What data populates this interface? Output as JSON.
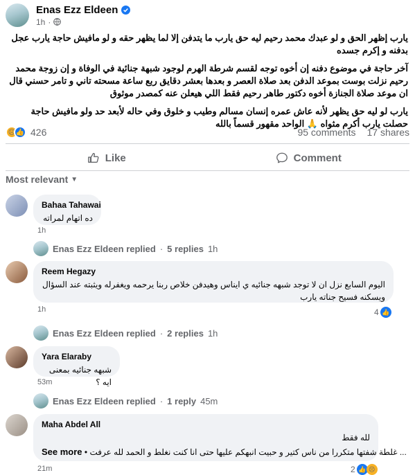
{
  "post": {
    "author": "Enas Ezz Eldeen",
    "time": "1h",
    "paragraphs": [
      "يارب إظهر الحق و لو عبدك محمد رحيم ليه حق يارب ما يتدفن إلا لما يظهر حقه و لو مافيش حاجة يارب عجل بدفنه و إكرم جسده",
      "آخر حاجة في موضوع دفنه إن أخوه توجه لقسم شرطة الهرم لوجود شبهة جنائية في الوفاة و إن زوجة محمد رحيم نزلت بوست بموعد الدفن بعد صلاة العصر و بعدها بعشر دقايق ربع ساعة مسحته تاني و تامر حسني قال ان موعد صلاة الجنازة أخوه دكتور طاهر رحيم فقط اللي هيعلن عنه كمصدر موثوق",
      "يارب لو ليه حق يظهر لأنه عاش عمره إنسان مسالم وطيب و خلوق وفي حاله لأبعد حد ولو مافيش حاجة حصلت يارب أكرم مثواه 🙏 الواحد مقهور قسماً بالله"
    ],
    "reaction_count": "426",
    "comments_count": "95 comments",
    "shares_count": "17 shares"
  },
  "actions": {
    "like": "Like",
    "comment": "Comment"
  },
  "sort_label": "Most relevant",
  "comments": [
    {
      "name": "Bahaa Tahawai",
      "text": "ده اتهام لمراته",
      "time": "1h",
      "reply_author": "Enas Ezz Eldeen replied",
      "reply_count": "5 replies",
      "reply_time": "1h"
    },
    {
      "name": "Reem Hegazy",
      "text": "اليوم السابع نزل ان لا توجد شبهه جنائيه ي ايناس وهيدفن خلاص ربنا يرحمه ويغفرله ويثبته عند السؤال ويسكنه فسيح جناته يارب",
      "time": "1h",
      "reactions": "4",
      "reply_author": "Enas Ezz Eldeen replied",
      "reply_count": "2 replies",
      "reply_time": "1h"
    },
    {
      "name": "Yara Elaraby",
      "text": "شبهه جنائيه بمعنى ايه ؟",
      "time": "53m",
      "reply_author": "Enas Ezz Eldeen replied",
      "reply_count": "1 reply",
      "reply_time": "45m"
    },
    {
      "name": "Maha Abdel All",
      "text": "لله فقط",
      "text2": "• غلطة شفتها متكررا من ناس كتير و حبيت انبهكم عليها حتى انا كنت نغلط و الحمد لله عرفت ...",
      "see_more": "See more",
      "time": "21m",
      "reactions": "2"
    }
  ],
  "colors": {
    "accent": "#1877f2",
    "bubble": "#f0f2f5",
    "secondary_text": "#65676b"
  }
}
